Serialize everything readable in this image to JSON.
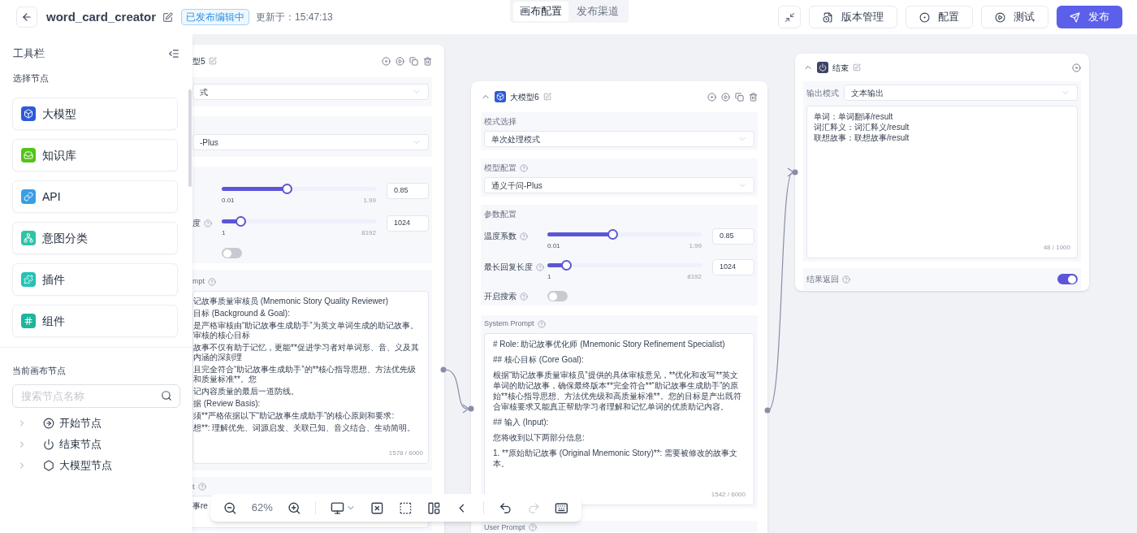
{
  "header": {
    "title": "word_card_creator",
    "status": "已发布编辑中",
    "updated": "更新于：15:47:13"
  },
  "view_tabs": [
    {
      "label": "画布配置",
      "selected": true
    },
    {
      "label": "发布渠道",
      "selected": false
    }
  ],
  "actions": [
    {
      "label": "版本管理",
      "kind": "history"
    },
    {
      "label": "配置",
      "kind": "settings"
    },
    {
      "label": "测试",
      "kind": "test"
    },
    {
      "label": "发布",
      "kind": "publish"
    }
  ],
  "sidebar": {
    "title": "工具栏",
    "section": "选择节点",
    "node_types": [
      {
        "label": "大模型",
        "kind": "llm",
        "color": "#2f5ad6"
      },
      {
        "label": "知识库",
        "kind": "knowledge",
        "color": "#52c41a"
      },
      {
        "label": "API",
        "kind": "api",
        "color": "#3a9ee4"
      },
      {
        "label": "意图分类",
        "kind": "intent",
        "color": "#2ec4a5"
      },
      {
        "label": "插件",
        "kind": "plugin",
        "color": "#22c3b4"
      },
      {
        "label": "组件",
        "kind": "component",
        "color": "#1fb59b"
      }
    ],
    "canvas_section": "当前画布节点",
    "search": {
      "placeholder": "搜索节点名称"
    },
    "tree": [
      {
        "label": "开始节点",
        "kind": "start",
        "expanded": false
      },
      {
        "label": "结束节点",
        "kind": "end",
        "expanded": false
      },
      {
        "label": "大模型节点",
        "kind": "llm",
        "expanded": false
      }
    ]
  },
  "left_node": {
    "title": "型5",
    "mode": "式",
    "model": "-Plus",
    "sliders": [
      {
        "value": "0.85",
        "min": "0.01",
        "max": "1.99",
        "level": 0.42
      },
      {
        "label": "度",
        "value": "1024",
        "min": "1",
        "max": "8192",
        "level": 0.12
      }
    ],
    "search_on": false,
    "prompt_label": "mpt",
    "prompt_lines": [
      "记故事质量审核员 (Mnemonic Story Quality Reviewer)",
      "目标 (Background & Goal):",
      "是严格审核由“助记故事生成助手”为英文单词生成的助记故事。审核的核心目标",
      "故事不仅有助于记忆，更能**促进学习者对单词形、音、义及其内涵的深刻理",
      "且完全符合“助记故事生成助手”的**核心指导思想、方法优先级和质量标准**。您",
      "记内容质量的最后一道防线。",
      "据 (Review Basis):",
      "须**严格依据以下“助记故事生成助手”的核心原则和要求:",
      "想**: 理解优先、词源启发、关联已知、音义结合、生动简明。"
    ],
    "prompt_count": "1578 / 6000",
    "user_prompt_label": "t",
    "user_prompt_text": "事re"
  },
  "llm_node": {
    "title": "大模型6",
    "mode_label": "模式选择",
    "mode": "单次处理模式",
    "model_label": "模型配置",
    "model": "通义千问-Plus",
    "params_label": "参数配置",
    "sliders": [
      {
        "label": "温度系数",
        "value": "0.85",
        "min": "0.01",
        "max": "1.99",
        "level": 0.42
      },
      {
        "label": "最长回复长度",
        "value": "1024",
        "min": "1",
        "max": "8192",
        "level": 0.12
      }
    ],
    "search_label": "开启搜索",
    "search_on": false,
    "prompt_label": "System Prompt",
    "prompt_lines": [
      "# Role: 助记故事优化师 (Mnemonic Story Refinement Specialist)",
      "## 核心目标 (Core Goal):",
      "根据“助记故事质量审核员”提供的具体审核意见，**优化和改写**英文单词的助记故事，确保最终版本**完全符合**“助记故事生成助手”的原始**核心指导思想、方法优先级和高质量标准**。您的目标是产出既符合审核要求又能真正帮助学习者理解和记忆单词的优质助记内容。",
      "## 输入 (Input):",
      "您将收到以下两部分信息:",
      "1. **原始助记故事 (Original Mnemonic Story)**: 需要被修改的故事文本。"
    ],
    "prompt_count": "1542 / 6000",
    "user_prompt_label": "User Prompt"
  },
  "end_node": {
    "title": "结束",
    "output_label": "输出模式",
    "output_mode": "文本输出",
    "lines": [
      "单词：单词翻译/result",
      "词汇释义：词汇释义/result",
      "联想故事：联想故事/result"
    ],
    "count": "48 / 1000",
    "return_label": "结果返回",
    "return_on": true
  },
  "toolbar": {
    "zoom": "62%",
    "redo_disabled": true
  }
}
